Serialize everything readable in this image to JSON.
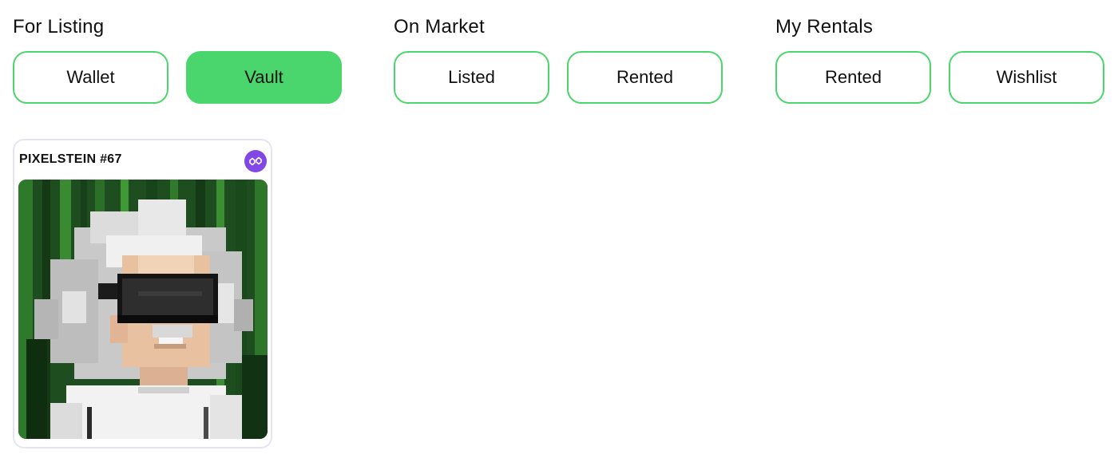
{
  "groups": [
    {
      "title": "For Listing",
      "buttons": [
        {
          "label": "Wallet",
          "active": false
        },
        {
          "label": "Vault",
          "active": true
        }
      ]
    },
    {
      "title": "On Market",
      "buttons": [
        {
          "label": "Listed",
          "active": false
        },
        {
          "label": "Rented",
          "active": false
        }
      ]
    },
    {
      "title": "My Rentals",
      "buttons": [
        {
          "label": "Rented",
          "active": false
        },
        {
          "label": "Wishlist",
          "active": false
        }
      ]
    }
  ],
  "card": {
    "title": "PIXELSTEIN #67",
    "chain_icon": "polygon-icon",
    "image": "pixel-art-einstein-vr-headset"
  },
  "colors": {
    "accent": "#4ad66d",
    "card_border": "#e4e6ef",
    "chain_badge": "#8247e5"
  }
}
